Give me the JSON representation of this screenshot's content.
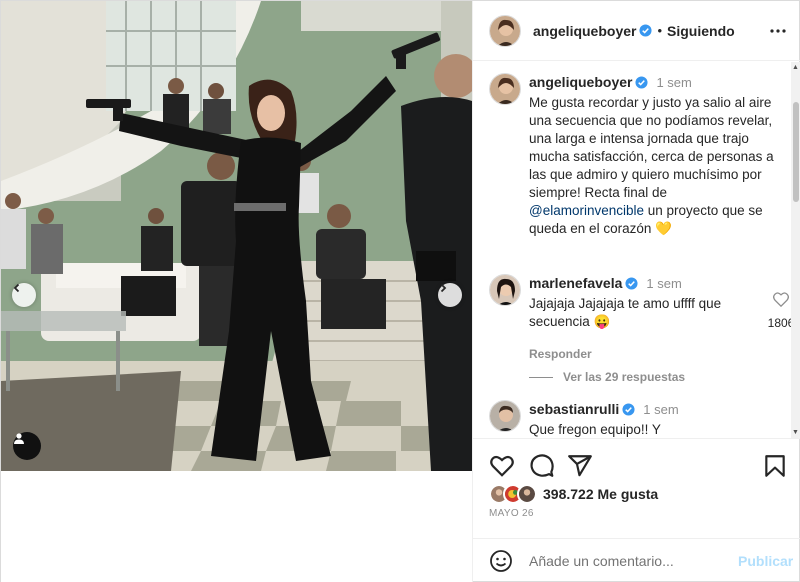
{
  "post": {
    "author": "angeliqueboyer",
    "follow_state": "Siguiendo",
    "separator": "•",
    "more_icon": "more-horizontal-icon"
  },
  "caption": {
    "author": "angeliqueboyer",
    "time": "1 sem",
    "text_before": "Me gusta recordar y justo ya salio al aire una secuencia que no podíamos revelar, una larga e intensa jornada que trajo mucha satisfacción, cerca de personas a las que admiro y quiero muchísimo por siempre! Recta final de ",
    "mention": "@elamorinvencible",
    "text_after": " un proyecto que se queda en el corazón 💛"
  },
  "comments": [
    {
      "author": "marlenefavela",
      "time": "1 sem",
      "text": "Jajajaja Jajajaja te amo uffff que secuencia 😛",
      "like_count": "1806",
      "reply_label": "Responder",
      "view_replies": "Ver las 29 respuestas"
    },
    {
      "author": "sebastianrulli",
      "time": "1 sem",
      "text": "Que fregon equipo!! Y"
    }
  ],
  "likes": {
    "count_text": "398.722 Me gusta"
  },
  "date": "MAYO 26",
  "composer": {
    "placeholder": "Añade un comentario...",
    "publish_label": "Publicar"
  },
  "colors": {
    "verified": "#3897f0",
    "publish_disabled": "#b2dffc",
    "wall_green": "#8fa38a"
  }
}
